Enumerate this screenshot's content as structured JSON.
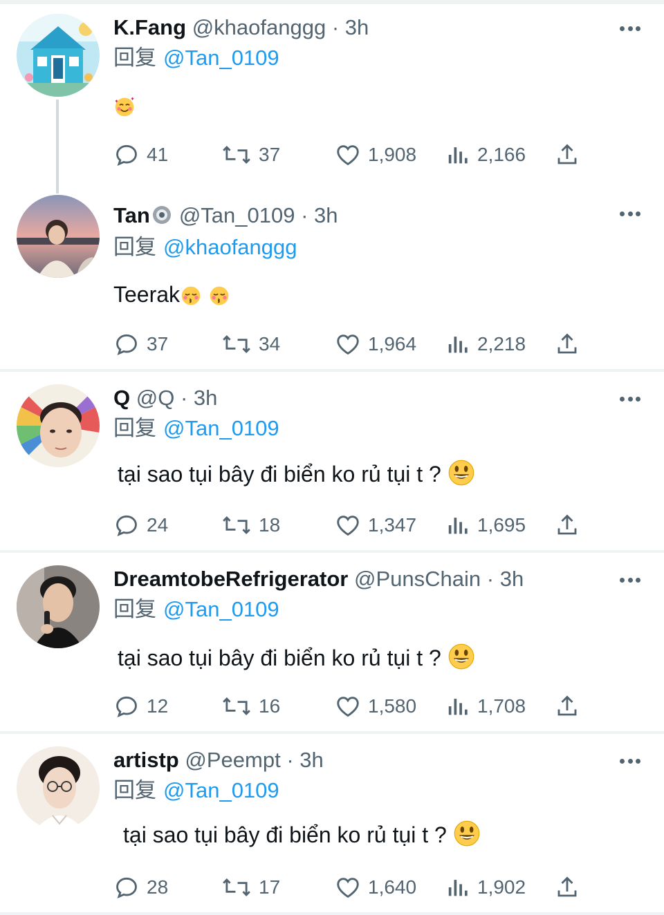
{
  "tweets": [
    {
      "name": "K.Fang",
      "handle": "@khaofanggg",
      "separator": "·",
      "time": "3h",
      "reply_prefix": "回复",
      "reply_to": "@Tan_0109",
      "text": "",
      "emoji": "smiling-face-with-hearts",
      "stats": {
        "replies": "41",
        "retweets": "37",
        "likes": "1,908",
        "views": "2,166"
      }
    },
    {
      "name": "Tan",
      "handle": "@Tan_0109",
      "separator": "·",
      "time": "3h",
      "reply_prefix": "回复",
      "reply_to": "@khaofanggg",
      "text": "Teerak",
      "emoji": "kissing-face-with-closed-eyes",
      "stats": {
        "replies": "37",
        "retweets": "34",
        "likes": "1,964",
        "views": "2,218"
      }
    },
    {
      "name": "Q",
      "handle": "@Q",
      "separator": "·",
      "time": "3h",
      "reply_prefix": "回复",
      "reply_to": "@Tan_0109",
      "text": "tại sao tụi bây đi biển ko rủ tụi t ?",
      "emoji": "grinning-face",
      "stats": {
        "replies": "24",
        "retweets": "18",
        "likes": "1,347",
        "views": "1,695"
      }
    },
    {
      "name": "DreamtobeRefrigerator",
      "handle": "@PunsChain",
      "separator": "·",
      "time": "3h",
      "reply_prefix": "回复",
      "reply_to": "@Tan_0109",
      "text": "tại sao tụi bây đi biển ko rủ tụi t ?",
      "emoji": "grinning-face",
      "stats": {
        "replies": "12",
        "retweets": "16",
        "likes": "1,580",
        "views": "1,708"
      }
    },
    {
      "name": "artistp",
      "handle": "@Peempt",
      "separator": "·",
      "time": "3h",
      "reply_prefix": "回复",
      "reply_to": "@Tan_0109",
      "text": "tại sao tụi bây đi biển ko rủ tụi t ?",
      "emoji": "grinning-face",
      "stats": {
        "replies": "28",
        "retweets": "17",
        "likes": "1,640",
        "views": "1,902"
      }
    }
  ],
  "icons": {
    "reply": "reply-icon",
    "retweet": "retweet-icon",
    "like": "like-icon",
    "views": "views-icon",
    "share": "share-icon",
    "more": "more-icon"
  },
  "colors": {
    "link": "#1d9bf0",
    "secondary_text": "#536471",
    "primary_text": "#0f1419",
    "divider": "#eff3f4",
    "thread_line": "#cfd9de"
  }
}
